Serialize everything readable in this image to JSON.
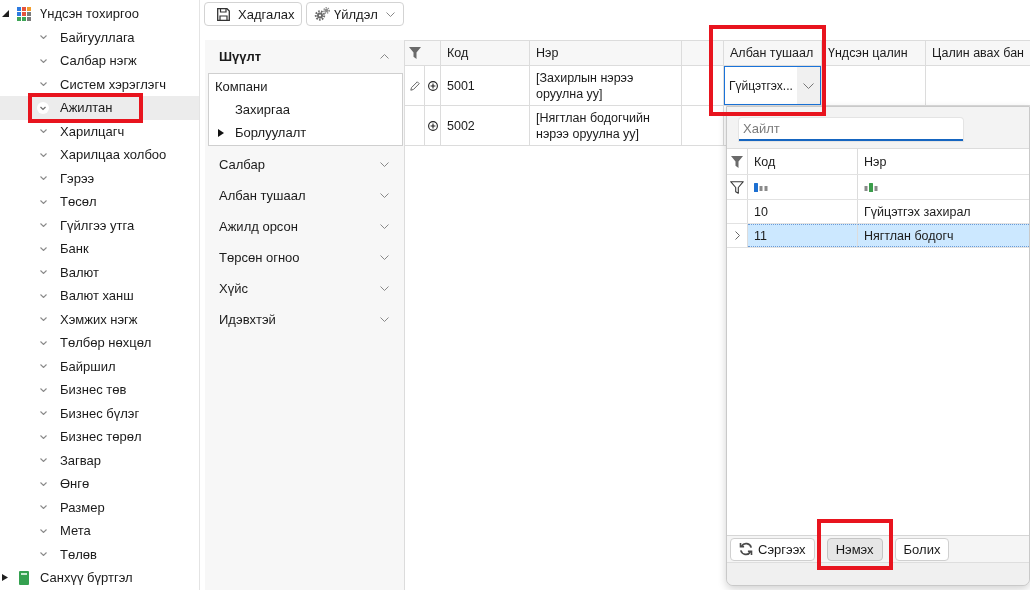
{
  "sidebar": {
    "items": [
      {
        "label": "Үндсэн тохиргоо",
        "expanded": true,
        "selected": false,
        "children": [
          {
            "label": "Байгууллага",
            "selected": false,
            "highlighted": false
          },
          {
            "label": "Салбар нэгж",
            "selected": false,
            "highlighted": false
          },
          {
            "label": "Систем хэрэглэгч",
            "selected": false,
            "highlighted": false
          },
          {
            "label": "Ажилтан",
            "selected": true,
            "highlighted": true
          },
          {
            "label": "Харилцагч",
            "selected": false,
            "highlighted": false
          },
          {
            "label": "Харилцаа холбоо",
            "selected": false,
            "highlighted": false
          },
          {
            "label": "Гэрээ",
            "selected": false,
            "highlighted": false
          },
          {
            "label": "Төсөл",
            "selected": false,
            "highlighted": false
          },
          {
            "label": "Гүйлгээ утга",
            "selected": false,
            "highlighted": false
          },
          {
            "label": "Банк",
            "selected": false,
            "highlighted": false
          },
          {
            "label": "Валют",
            "selected": false,
            "highlighted": false
          },
          {
            "label": "Валют ханш",
            "selected": false,
            "highlighted": false
          },
          {
            "label": "Хэмжих нэгж",
            "selected": false,
            "highlighted": false
          },
          {
            "label": "Төлбөр нөхцөл",
            "selected": false,
            "highlighted": false
          },
          {
            "label": "Байршил",
            "selected": false,
            "highlighted": false
          },
          {
            "label": "Бизнес төв",
            "selected": false,
            "highlighted": false
          },
          {
            "label": "Бизнес бүлэг",
            "selected": false,
            "highlighted": false
          },
          {
            "label": "Бизнес төрөл",
            "selected": false,
            "highlighted": false
          },
          {
            "label": "Загвар",
            "selected": false,
            "highlighted": false
          },
          {
            "label": "Өнгө",
            "selected": false,
            "highlighted": false
          },
          {
            "label": "Размер",
            "selected": false,
            "highlighted": false
          },
          {
            "label": "Мета",
            "selected": false,
            "highlighted": false
          },
          {
            "label": "Төлөв",
            "selected": false,
            "highlighted": false
          }
        ]
      },
      {
        "label": "Санхүү бүртгэл",
        "expanded": false,
        "selected": false
      }
    ]
  },
  "toolbar": {
    "buttons": [
      {
        "label": "Хадгалах",
        "kind": "save"
      },
      {
        "label": "Үйлдэл",
        "kind": "menu"
      }
    ]
  },
  "filter_panel": {
    "sections": [
      {
        "title": "Шүүлт",
        "expanded": true,
        "tree": [
          {
            "label": "Компани",
            "selected": false,
            "children": [
              {
                "label": "Захиргаа",
                "selected": false
              },
              {
                "label": "Борлуулалт",
                "selected": true
              }
            ]
          }
        ]
      },
      {
        "title": "Салбар",
        "expanded": false
      },
      {
        "title": "Албан тушаал",
        "expanded": false
      },
      {
        "title": "Ажилд орсон",
        "expanded": false
      },
      {
        "title": "Төрсөн огноо",
        "expanded": false
      },
      {
        "title": "Хүйс",
        "expanded": false
      },
      {
        "title": "Идэвхтэй",
        "expanded": false
      }
    ]
  },
  "grid": {
    "columns": [
      {
        "kind": "code",
        "label": "Код"
      },
      {
        "kind": "name",
        "label": "Нэр"
      },
      {
        "kind": "blank"
      },
      {
        "kind": "position",
        "label": "Албан тушаал"
      },
      {
        "kind": "salary",
        "label": "Үндсэн цалин"
      },
      {
        "kind": "bank",
        "label": "Цалин авах бан"
      }
    ],
    "rows": [
      {
        "editing": true,
        "expanded": false,
        "code": "5001",
        "name": "[Захирлын нэрээ оруулна уу]",
        "position": {
          "value": "Гүйцэтгэх...",
          "open": true,
          "highlighted": true,
          "dropdown": {
            "search": {
              "placeholder": "Хайлт"
            },
            "columns": [
              {
                "kind": "code",
                "label": "Код"
              },
              {
                "kind": "name",
                "label": "Нэр"
              }
            ],
            "rows": [
              {
                "code": "10",
                "name": "Гүйцэтгэх захирал",
                "selected": false
              },
              {
                "code": "11",
                "name": "Нягтлан бодогч",
                "selected": true
              }
            ],
            "buttons": [
              {
                "label": "Сэргээх",
                "kind": "refresh",
                "pressed": false,
                "highlighted": false
              },
              {
                "label": "Нэмэх",
                "kind": "plain",
                "pressed": true,
                "highlighted": true
              },
              {
                "label": "Болих",
                "kind": "plain",
                "pressed": false,
                "highlighted": false
              }
            ]
          }
        }
      },
      {
        "editing": false,
        "expanded": false,
        "code": "5002",
        "name": "[Нягтлан бодогчийн нэрээ оруулна уу]"
      }
    ]
  }
}
